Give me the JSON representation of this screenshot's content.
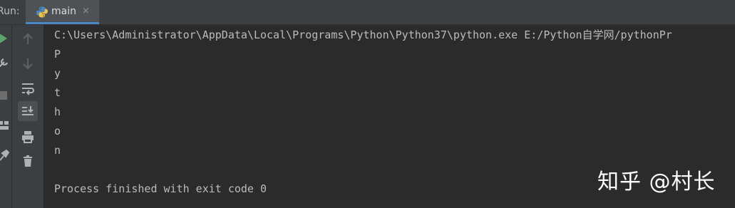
{
  "run_panel": {
    "label": "Run:",
    "tab": {
      "label": "main",
      "close": "×",
      "icon": "python-file-icon"
    }
  },
  "left_strip_icons": [
    "rerun-icon",
    "wrench-icon",
    "stop-icon",
    "layout-icon",
    "pin-icon"
  ],
  "toolbar_icons": [
    "arrow-up-icon",
    "arrow-down-icon",
    "soft-wrap-icon",
    "scroll-to-end-icon",
    "print-icon",
    "trash-icon"
  ],
  "console": {
    "command": "C:\\Users\\Administrator\\AppData\\Local\\Programs\\Python\\Python37\\python.exe E:/Python自学网/pythonPr",
    "output": [
      "P",
      "y",
      "t",
      "h",
      "o",
      "n"
    ],
    "exit_message": "Process finished with exit code 0"
  },
  "watermark": "知乎 @村长",
  "colors": {
    "run_green": "#59a869",
    "tab_underline": "#4a88c7",
    "console_text": "#bbbbbb"
  }
}
